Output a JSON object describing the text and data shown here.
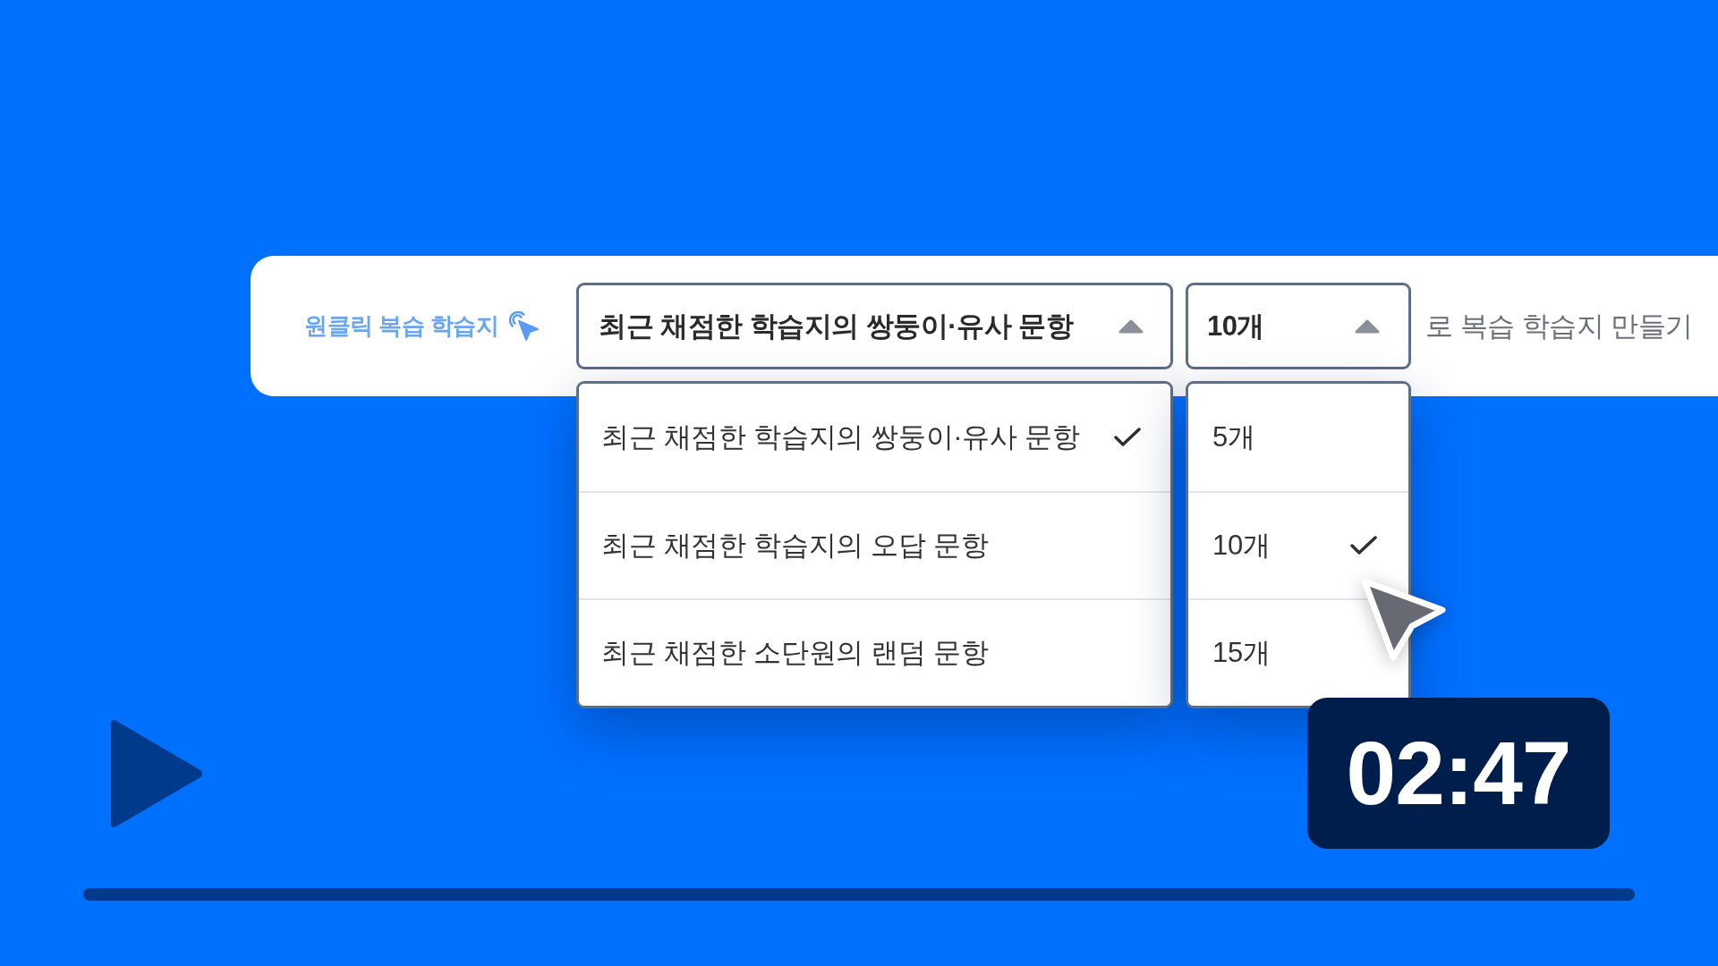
{
  "banner": {
    "label": "원클릭 복습 학습지"
  },
  "selects": [
    {
      "value": "최근 채점한 학습지의 쌍둥이·유사 문항",
      "expanded": true,
      "options": [
        {
          "label": "최근 채점한 학습지의 쌍둥이·유사 문항",
          "selected": true
        },
        {
          "label": "최근 채점한 학습지의 오답 문항",
          "selected": false
        },
        {
          "label": "최근 채점한 소단원의 랜덤 문항",
          "selected": false
        }
      ]
    },
    {
      "value": "10개",
      "expanded": true,
      "options": [
        {
          "label": "5개",
          "selected": false
        },
        {
          "label": "10개",
          "selected": true
        },
        {
          "label": "15개",
          "selected": false
        }
      ]
    }
  ],
  "suffix": "로 복습 학습지 만들기",
  "video": {
    "duration": "02:47"
  }
}
